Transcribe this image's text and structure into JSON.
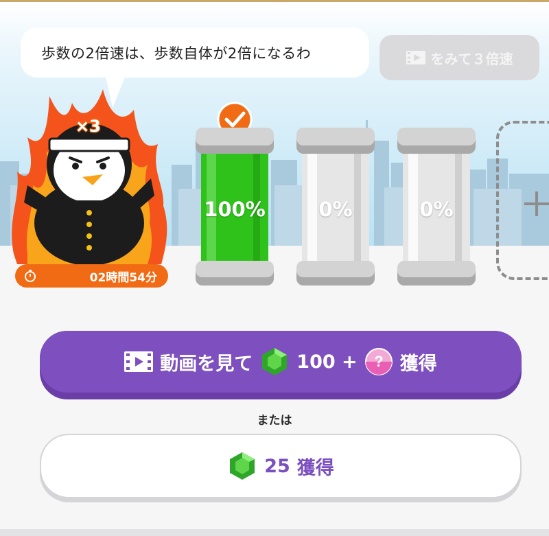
{
  "speech_bubble": {
    "text": "歩数の2倍速は、歩数自体が2倍になるわ"
  },
  "boost_button": {
    "label": "をみて３倍速"
  },
  "mascot": {
    "multiplier": "×3",
    "timer": "02時間54分"
  },
  "batteries": [
    {
      "label": "100%",
      "level": 1.0,
      "claimed": true
    },
    {
      "label": "0%",
      "level": 0.0,
      "claimed": false
    },
    {
      "label": "0%",
      "level": 0.0,
      "claimed": false
    }
  ],
  "watch_button": {
    "text_before": "動画を見て",
    "gems": "100 +",
    "text_after": "獲得"
  },
  "or_label": "または",
  "gem_button": {
    "amount": "25",
    "label": "獲得"
  },
  "colors": {
    "accent": "#7e4fbe",
    "battery_full": "#2fc21b",
    "timer_bg": "#f06b14"
  }
}
